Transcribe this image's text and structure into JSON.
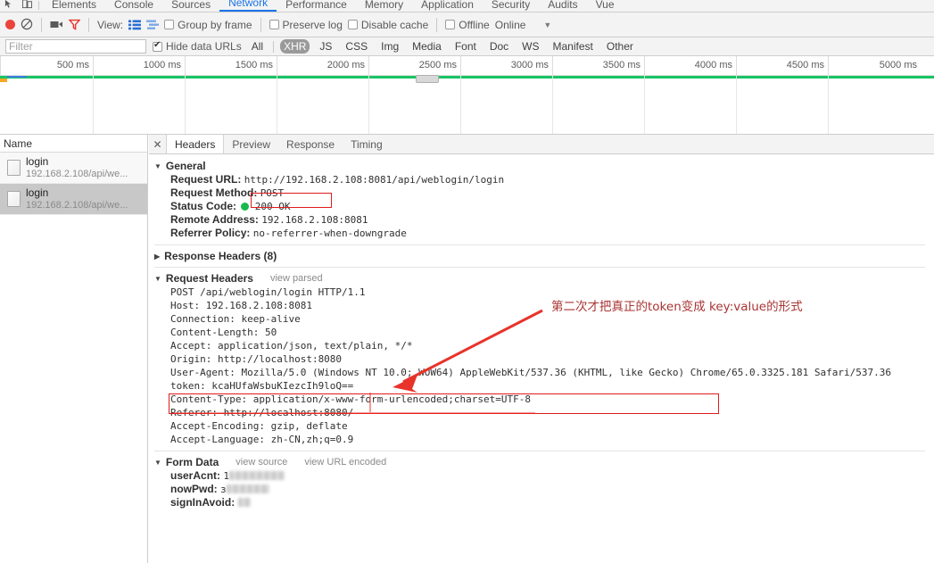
{
  "devtools": {
    "tabs": [
      {
        "label": "Elements",
        "active": false
      },
      {
        "label": "Console",
        "active": false
      },
      {
        "label": "Sources",
        "active": false
      },
      {
        "label": "Network",
        "active": true
      },
      {
        "label": "Performance",
        "active": false
      },
      {
        "label": "Memory",
        "active": false
      },
      {
        "label": "Application",
        "active": false
      },
      {
        "label": "Security",
        "active": false
      },
      {
        "label": "Audits",
        "active": false
      },
      {
        "label": "Vue",
        "active": false
      }
    ],
    "inspect_icon": "inspect-element-icon",
    "device_icon": "device-toolbar-icon"
  },
  "toolbar": {
    "record_icon": "record-icon",
    "clear_icon": "clear-icon",
    "capture_screenshots_icon": "camera-icon",
    "filter_icon": "funnel-icon",
    "view_label": "View:",
    "view_list_icon": "list-view-icon",
    "view_waterfall_icon": "waterfall-view-icon",
    "group_by_frame": {
      "label": "Group by frame",
      "checked": false
    },
    "preserve_log": {
      "label": "Preserve log",
      "checked": false
    },
    "disable_cache": {
      "label": "Disable cache",
      "checked": false
    },
    "offline": {
      "label": "Offline",
      "checked": false
    },
    "throttling": {
      "label": "Online",
      "caret_icon": "chevron-down-icon"
    }
  },
  "filterbar": {
    "filter_placeholder": "Filter",
    "filter_value": "",
    "hide_data_urls": {
      "label": "Hide data URLs",
      "checked": true
    },
    "types": [
      {
        "label": "All",
        "selected": false
      },
      {
        "label": "XHR",
        "selected": true
      },
      {
        "label": "JS",
        "selected": false
      },
      {
        "label": "CSS",
        "selected": false
      },
      {
        "label": "Img",
        "selected": false
      },
      {
        "label": "Media",
        "selected": false
      },
      {
        "label": "Font",
        "selected": false
      },
      {
        "label": "Doc",
        "selected": false
      },
      {
        "label": "WS",
        "selected": false
      },
      {
        "label": "Manifest",
        "selected": false
      },
      {
        "label": "Other",
        "selected": false
      }
    ]
  },
  "overview": {
    "ticks": [
      "500 ms",
      "1000 ms",
      "1500 ms",
      "2000 ms",
      "2500 ms",
      "3000 ms",
      "3500 ms",
      "4000 ms",
      "4500 ms",
      "5000 ms"
    ],
    "load_bar_color": "#19c463",
    "domcontent_color": "#3b7fe0"
  },
  "requests": {
    "column_header": "Name",
    "rows": [
      {
        "name": "login",
        "url": "192.168.2.108/api/we...",
        "selected": false
      },
      {
        "name": "login",
        "url": "192.168.2.108/api/we...",
        "selected": true
      }
    ]
  },
  "detail": {
    "close_icon": "close-icon",
    "tabs": [
      {
        "label": "Headers",
        "active": true
      },
      {
        "label": "Preview",
        "active": false
      },
      {
        "label": "Response",
        "active": false
      },
      {
        "label": "Timing",
        "active": false
      }
    ],
    "general": {
      "title": "General",
      "expanded": true,
      "rows": [
        {
          "key": "Request URL:",
          "value": "http://192.168.2.108:8081/api/weblogin/login"
        },
        {
          "key": "Request Method:",
          "value": "POST",
          "highlighted": true
        },
        {
          "key": "Status Code:",
          "value": "200 OK",
          "status_dot": true
        },
        {
          "key": "Remote Address:",
          "value": "192.168.2.108:8081"
        },
        {
          "key": "Referrer Policy:",
          "value": "no-referrer-when-downgrade"
        }
      ]
    },
    "response_headers": {
      "title": "Response Headers (8)",
      "expanded": false
    },
    "request_headers": {
      "title": "Request Headers",
      "action": "view parsed",
      "expanded": true,
      "lines": [
        "POST /api/weblogin/login HTTP/1.1",
        "Host: 192.168.2.108:8081",
        "Connection: keep-alive",
        "Content-Length: 50",
        "Accept: application/json, text/plain, */*",
        "Origin: http://localhost:8080",
        "User-Agent: Mozilla/5.0 (Windows NT 10.0; WOW64) AppleWebKit/537.36 (KHTML, like Gecko) Chrome/65.0.3325.181 Safari/537.36",
        "token: kcaHUfaWsbuKIezcIh9loQ==",
        "Content-Type: application/x-www-form-urlencoded;charset=UTF-8",
        "Referer: http://localhost:8080/",
        "Accept-Encoding: gzip, deflate",
        "Accept-Language: zh-CN,zh;q=0.9"
      ]
    },
    "form_data": {
      "title": "Form Data",
      "action_source": "view source",
      "action_url_encoded": "view URL encoded",
      "expanded": true,
      "rows": [
        {
          "key": "userAcnt:",
          "value": "1",
          "redacted": true,
          "redact_width": 64
        },
        {
          "key": "nowPwd:",
          "value": "з",
          "redacted": true,
          "redact_width": 50
        },
        {
          "key": "signInAvoid:",
          "value": "",
          "redacted": true,
          "redact_width": 14
        }
      ]
    }
  },
  "annotations": {
    "note_text": "第二次才把真正的token变成 key:value的形式",
    "note_color": "#a33333",
    "box_color": "#e01b1b",
    "arrow_color": "#e8332a"
  }
}
